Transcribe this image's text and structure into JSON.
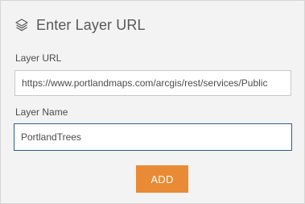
{
  "header": {
    "title": "Enter Layer URL",
    "icon": "layers-icon"
  },
  "form": {
    "url_label": "Layer URL",
    "url_value": "https://www.portlandmaps.com/arcgis/rest/services/Public",
    "name_label": "Layer Name",
    "name_value": "PortlandTrees"
  },
  "actions": {
    "add_label": "ADD"
  },
  "colors": {
    "accent": "#e88b34",
    "focus_border": "#2b5d8f",
    "panel_bg": "#f3f3f3"
  }
}
